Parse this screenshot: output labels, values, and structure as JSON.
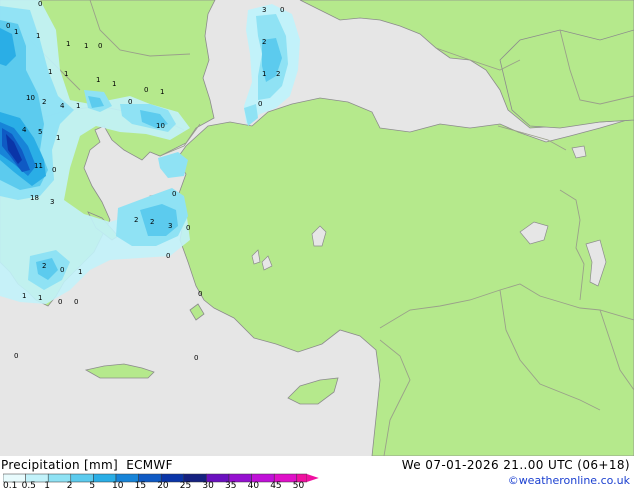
{
  "map": {
    "title": "Precipitation [mm]",
    "model": "ECMWF",
    "valid_time": "We 07-01-2026 21..00 UTC (06+18)",
    "credit": "©weatheronline.co.uk",
    "colors": {
      "land": "#b5e98c",
      "sea": "#e6e6e6",
      "border": "#9aa08a",
      "coast": "#8c8c8c"
    },
    "legend": {
      "labels": [
        "0.1",
        "0.5",
        "1",
        "2",
        "5",
        "10",
        "15",
        "20",
        "25",
        "30",
        "35",
        "40",
        "45",
        "50"
      ],
      "colors": [
        "#e8fbfd",
        "#c2f2fa",
        "#8fe2f4",
        "#5ccbee",
        "#2aaee6",
        "#1784d8",
        "#0f5ac4",
        "#0a35a8",
        "#152180",
        "#6a10bf",
        "#9510d0",
        "#c010d8",
        "#df10c8",
        "#f010a0"
      ]
    },
    "precip_labels": [
      "0",
      "1",
      "1",
      "0",
      "3",
      "1",
      "2",
      "0",
      "1",
      "1",
      "2",
      "1",
      "1",
      "0",
      "1",
      "1",
      "0",
      "10",
      "2",
      "4",
      "1",
      "0",
      "1",
      "0",
      "10",
      "4",
      "5",
      "1",
      "11",
      "0",
      "18",
      "3",
      "2",
      "2",
      "3",
      "0",
      "0",
      "2",
      "0",
      "1",
      "0",
      "1",
      "1",
      "0",
      "0",
      "0",
      "0",
      "0"
    ]
  }
}
